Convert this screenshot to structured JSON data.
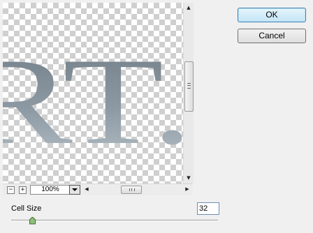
{
  "preview": {
    "text": "RT.",
    "zoom_value": "100%",
    "zoom_out_label": "−",
    "zoom_in_label": "+"
  },
  "scrollbars": {
    "up_arrow": "▲",
    "down_arrow": "▼",
    "left_arrow": "◀",
    "right_arrow": "▶"
  },
  "buttons": {
    "ok": "OK",
    "cancel": "Cancel"
  },
  "cell_size": {
    "label": "Cell Size",
    "value": "32"
  }
}
